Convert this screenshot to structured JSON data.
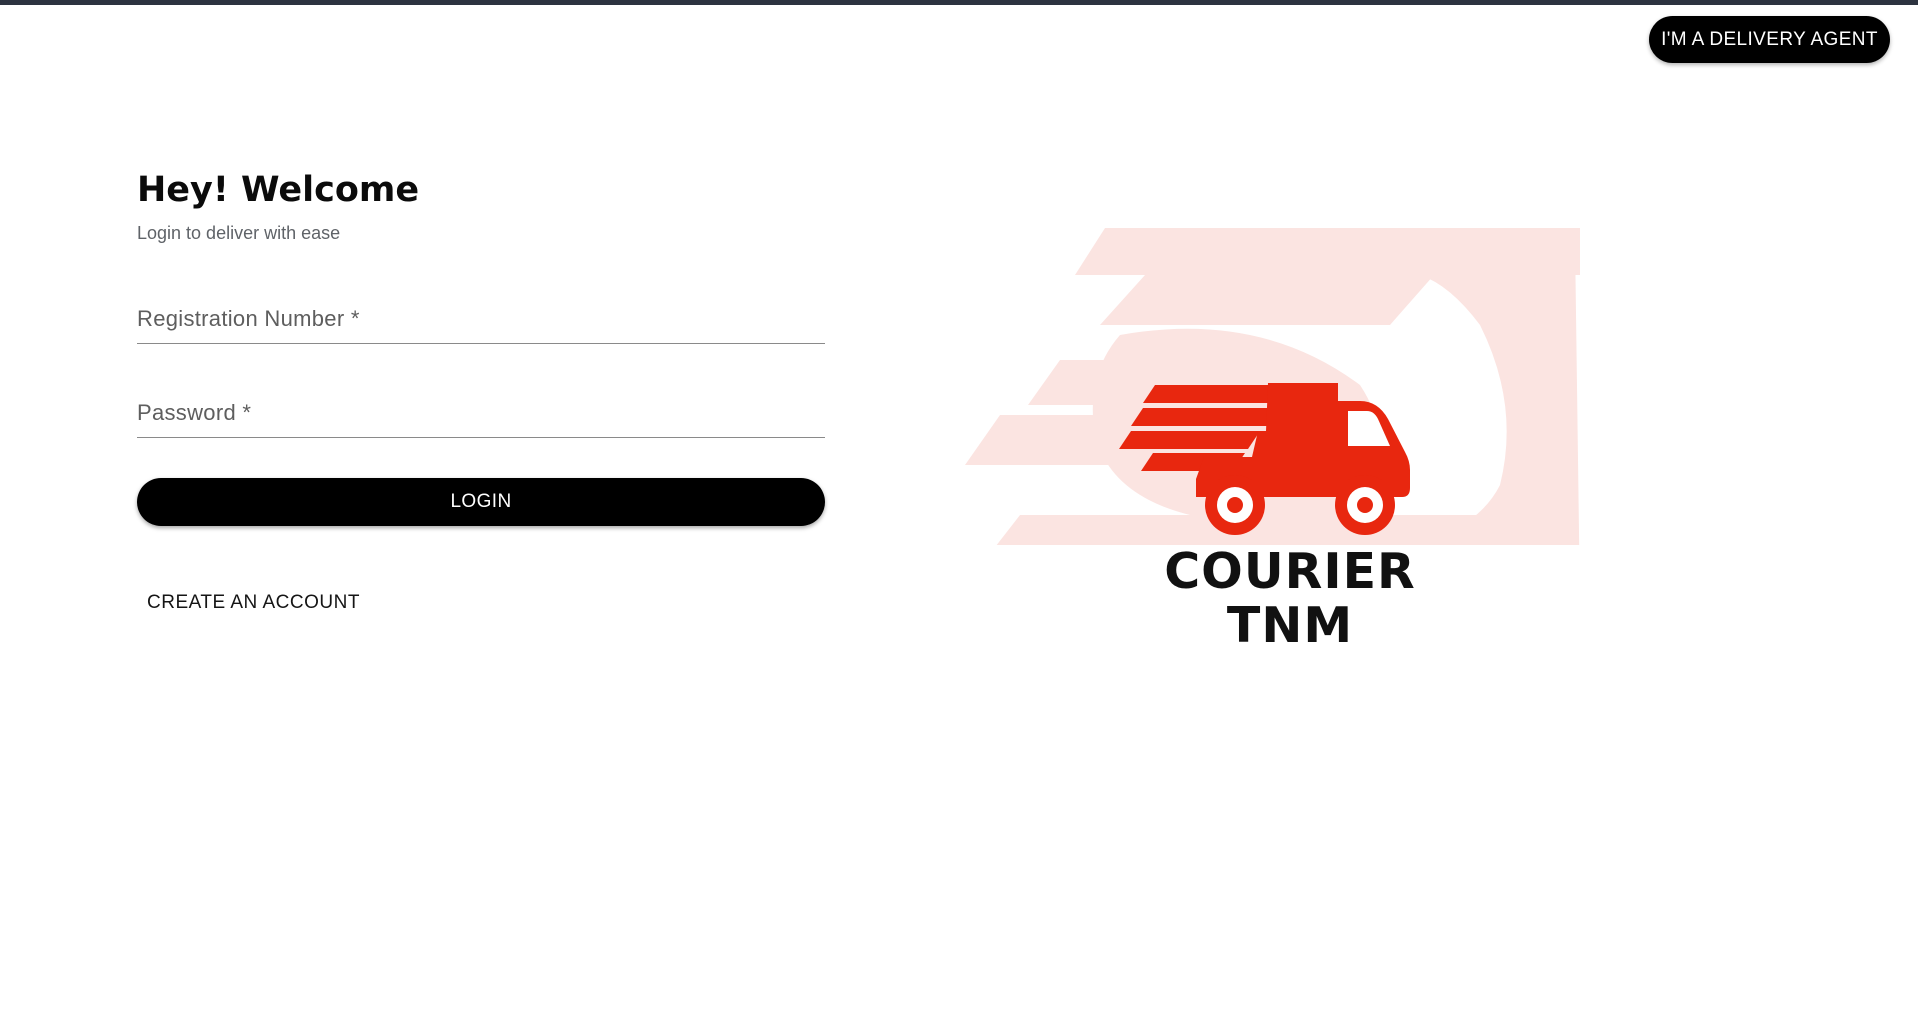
{
  "header": {
    "agent_button_label": "I'M A DELIVERY AGENT"
  },
  "login": {
    "title": "Hey! Welcome",
    "subtitle": "Login to deliver with ease",
    "registration_placeholder": "Registration Number *",
    "password_placeholder": "Password *",
    "login_label": "LOGIN",
    "create_account_label": "CREATE AN ACCOUNT"
  },
  "logo": {
    "brand_line_1": "COURIER",
    "brand_line_2": "TNM",
    "truck_icon": "delivery-truck-icon",
    "colors": {
      "truck": "#e8270f",
      "watermark": "#fbe4e1",
      "text": "#111111"
    }
  }
}
